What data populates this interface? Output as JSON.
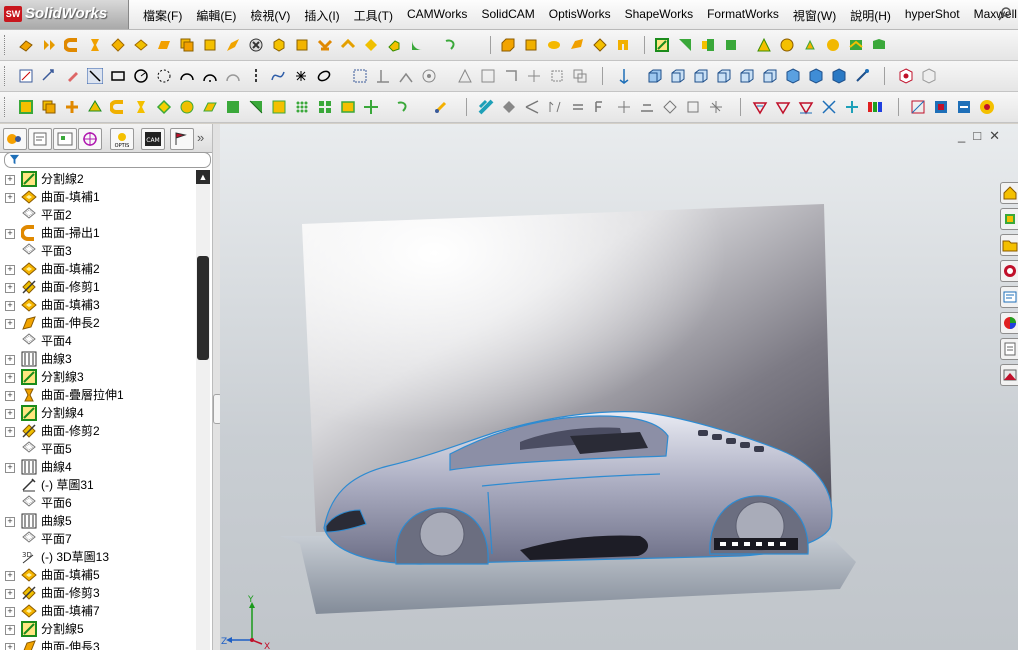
{
  "app": {
    "logo_badge": "SW",
    "name": "SolidWorks"
  },
  "menubar": {
    "items": [
      "檔案(F)",
      "編輯(E)",
      "檢視(V)",
      "插入(I)",
      "工具(T)",
      "CAMWorks",
      "SolidCAM",
      "OptisWorks",
      "ShapeWorks",
      "FormatWorks",
      "視窗(W)",
      "說明(H)",
      "hyperShot",
      "Maxwell"
    ]
  },
  "feature_tree": {
    "panel_tabs": [
      "feature-manager",
      "property-manager",
      "configuration-manager",
      "dimxpert",
      "optis",
      "cam",
      "display-manager"
    ],
    "items": [
      {
        "label": "分割線2",
        "icon": "split-line-icon",
        "expandable": true
      },
      {
        "label": "曲面-填補1",
        "icon": "fill-surface-icon",
        "expandable": true
      },
      {
        "label": "平面2",
        "icon": "plane-icon",
        "expandable": false
      },
      {
        "label": "曲面-掃出1",
        "icon": "sweep-surface-icon",
        "expandable": true
      },
      {
        "label": "平面3",
        "icon": "plane-icon",
        "expandable": false
      },
      {
        "label": "曲面-填補2",
        "icon": "fill-surface-icon",
        "expandable": true
      },
      {
        "label": "曲面-修剪1",
        "icon": "trim-surface-icon",
        "expandable": true
      },
      {
        "label": "曲面-填補3",
        "icon": "fill-surface-icon",
        "expandable": true
      },
      {
        "label": "曲面-伸長2",
        "icon": "extend-surface-icon",
        "expandable": true
      },
      {
        "label": "平面4",
        "icon": "plane-icon",
        "expandable": false
      },
      {
        "label": "曲線3",
        "icon": "curve-icon",
        "expandable": true
      },
      {
        "label": "分割線3",
        "icon": "split-line-icon",
        "expandable": true
      },
      {
        "label": "曲面-疊層拉伸1",
        "icon": "loft-surface-icon",
        "expandable": true
      },
      {
        "label": "分割線4",
        "icon": "split-line-icon",
        "expandable": true
      },
      {
        "label": "曲面-修剪2",
        "icon": "trim-surface-icon",
        "expandable": true
      },
      {
        "label": "平面5",
        "icon": "plane-icon",
        "expandable": false
      },
      {
        "label": "曲線4",
        "icon": "curve-icon",
        "expandable": true
      },
      {
        "label": "(-) 草圖31",
        "icon": "sketch-icon",
        "expandable": false
      },
      {
        "label": "平面6",
        "icon": "plane-icon",
        "expandable": false
      },
      {
        "label": "曲線5",
        "icon": "curve-icon",
        "expandable": true
      },
      {
        "label": "平面7",
        "icon": "plane-icon",
        "expandable": false
      },
      {
        "label": "(-) 3D草圖13",
        "icon": "3d-sketch-icon",
        "expandable": false
      },
      {
        "label": "曲面-填補5",
        "icon": "fill-surface-icon",
        "expandable": true
      },
      {
        "label": "曲面-修剪3",
        "icon": "trim-surface-icon",
        "expandable": true
      },
      {
        "label": "曲面-填補7",
        "icon": "fill-surface-icon",
        "expandable": true
      },
      {
        "label": "分割線5",
        "icon": "split-line-icon",
        "expandable": true
      },
      {
        "label": "曲面-伸長3",
        "icon": "extend-surface-icon",
        "expandable": true
      }
    ]
  },
  "viewport": {
    "window_controls": [
      "_",
      "□",
      "✕"
    ],
    "triad_axes": [
      "Y",
      "Z",
      "X"
    ]
  },
  "colors": {
    "accent": "#c8161d",
    "surface_blue": "#2e8bd1",
    "toolbar_yellow": "#f2c400",
    "icon_green": "#3aa83a"
  }
}
